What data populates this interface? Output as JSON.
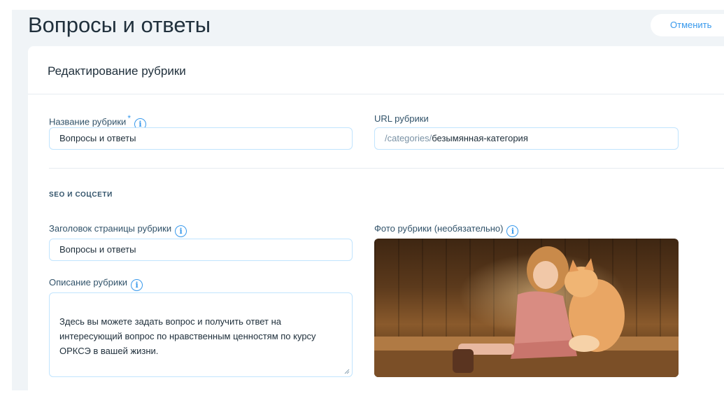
{
  "page": {
    "title": "Вопросы и ответы"
  },
  "header": {
    "cancel_label": "Отменить"
  },
  "panel": {
    "title": "Редактирование рубрики",
    "name_field": {
      "label": "Название рубрики",
      "required_mark": "*",
      "value": "Вопросы и ответы"
    },
    "url_field": {
      "label": "URL рубрики",
      "prefix": "/categories/",
      "value": "безымянная-категория"
    },
    "seo": {
      "section_title": "SEO И СОЦСЕТИ",
      "page_title_field": {
        "label": "Заголовок страницы рубрики",
        "value": "Вопросы и ответы"
      },
      "description_field": {
        "label": "Описание рубрики",
        "value": "Здесь вы можете задать вопрос и получить ответ на интересующий вопрос по нравственным ценностям по курсу ОРКСЭ в вашей жизни."
      },
      "photo_field": {
        "label": "Фото рубрики (необязательно)"
      }
    }
  },
  "icons": {
    "info": "i"
  },
  "colors": {
    "accent": "#3899ec",
    "background": "#f0f4f7",
    "field_border": "#c1e4fe",
    "text": "#20303c"
  }
}
